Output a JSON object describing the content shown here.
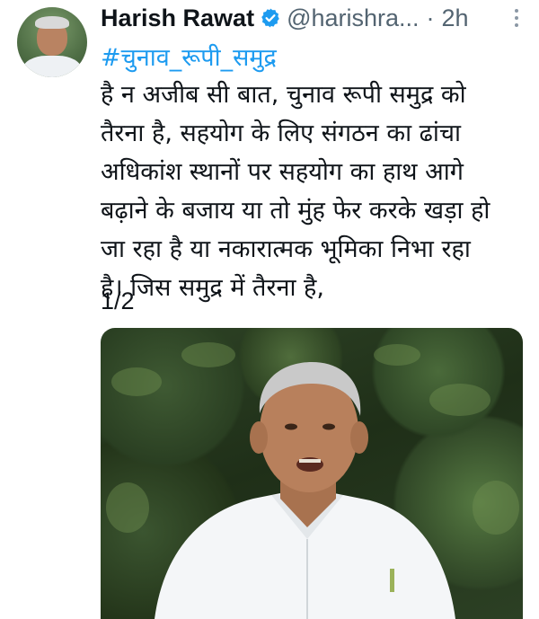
{
  "tweet": {
    "author_name": "Harish Rawat",
    "handle": "@harishra...",
    "separator": "·",
    "time": "2h",
    "hashtag": "#चुनाव_रूपी_समुद्र",
    "lines": [
      "है न अजीब सी बात, चुनाव रूपी समुद्र को",
      "तैरना है, सहयोग के लिए संगठन का ढांचा",
      "अधिकांश स्थानों पर सहयोग का हाथ आगे",
      "बढ़ाने के बजाय या तो मुंह फेर करके खड़ा हो",
      "जा रहा है या नकारात्मक भूमिका निभा रहा",
      "है। जिस समुद्र में तैरना है,"
    ],
    "thread_counter": "1/2"
  },
  "icons": {
    "verified": "verified-badge-icon",
    "more": "more-options-icon"
  },
  "colors": {
    "link": "#1d9bf0",
    "secondary_text": "#536471",
    "verified": "#1d9bf0"
  }
}
